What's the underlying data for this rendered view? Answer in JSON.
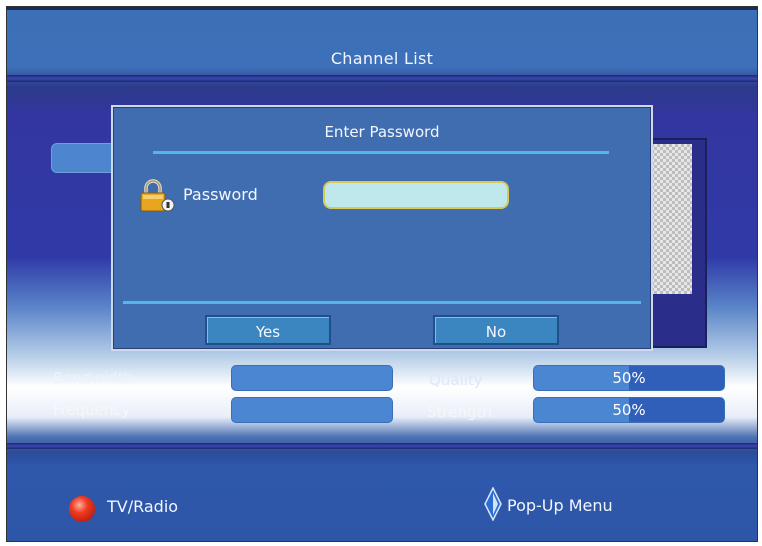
{
  "header": {
    "title": "Channel List"
  },
  "dialog": {
    "title": "Enter Password",
    "password_label": "Password",
    "password_value": "",
    "yes_label": "Yes",
    "no_label": "No",
    "icon": "padlock-icon"
  },
  "signal_info": {
    "bandwidth_label": "Bandwidth",
    "frequency_label": "Frequency",
    "quality_label": "Quality",
    "strength_label": "Strength",
    "bandwidth_value": "",
    "frequency_value": "",
    "quality_text": "50%",
    "strength_text": "50%",
    "quality_fraction": 0.5,
    "strength_fraction": 0.5
  },
  "footer": {
    "tv_radio_label": "TV/Radio",
    "popup_menu_label": "Pop-Up Menu",
    "red_button_icon": "red-button-icon",
    "nav_icon": "nav-arrow-icon"
  },
  "colors": {
    "accent_line": "#56b7e6",
    "dialog_bg": "#3f6db0",
    "input_bg": "#bfe8ec",
    "input_border": "#d8c85a",
    "red_button": "#f03a20"
  }
}
